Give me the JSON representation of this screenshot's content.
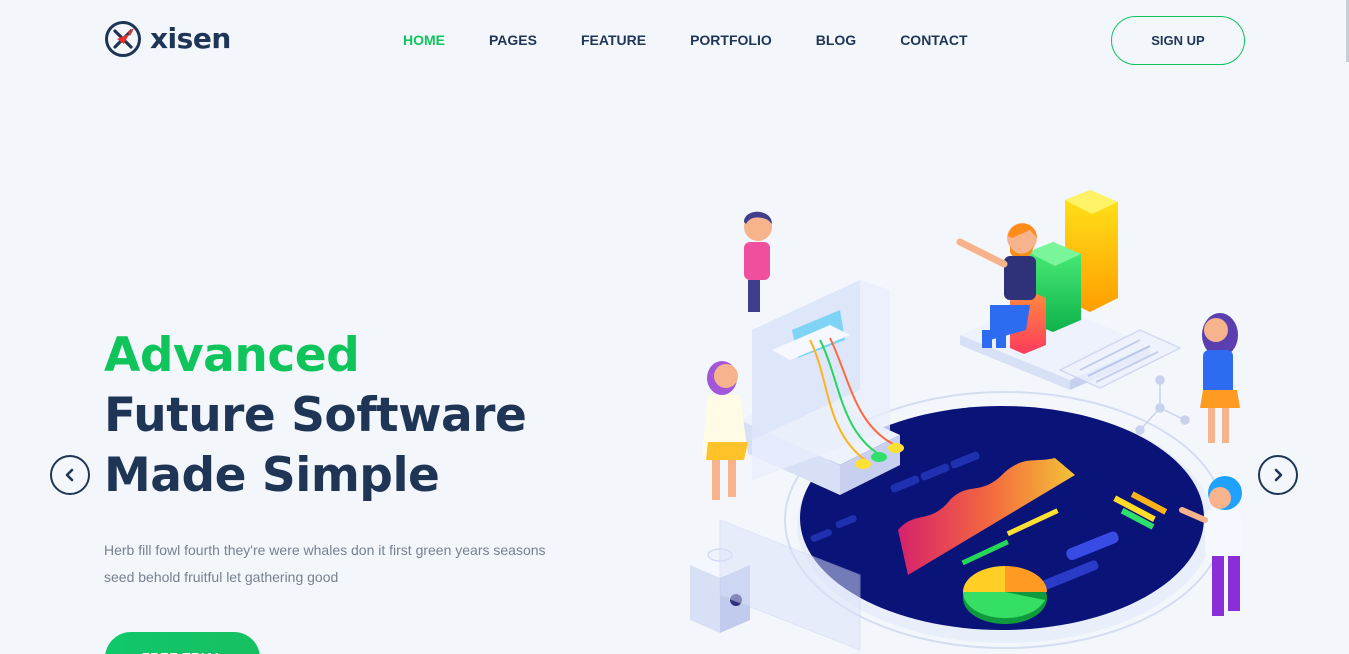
{
  "brand": {
    "name": "xisen",
    "logo_icon": "x-mark-logo-icon"
  },
  "nav": {
    "items": [
      {
        "label": "HOME",
        "active": true
      },
      {
        "label": "PAGES",
        "active": false
      },
      {
        "label": "FEATURE",
        "active": false
      },
      {
        "label": "PORTFOLIO",
        "active": false
      },
      {
        "label": "BLOG",
        "active": false
      },
      {
        "label": "CONTACT",
        "active": false
      }
    ],
    "signup_label": "SIGN UP"
  },
  "hero": {
    "title_highlight": "Advanced",
    "title_line2": "Future Software",
    "title_line3": "Made Simple",
    "description": "Herb fill fowl fourth they're were whales don it first green years seasons seed behold fruitful let gathering good",
    "cta_label": "FREE TRIAL"
  },
  "carousel": {
    "prev_icon": "chevron-left-icon",
    "next_icon": "chevron-right-icon"
  },
  "colors": {
    "accent": "#10c45c",
    "heading": "#1f3556",
    "text": "#77808f",
    "background": "#f3f7fc",
    "dashboard": "#0a1378"
  }
}
